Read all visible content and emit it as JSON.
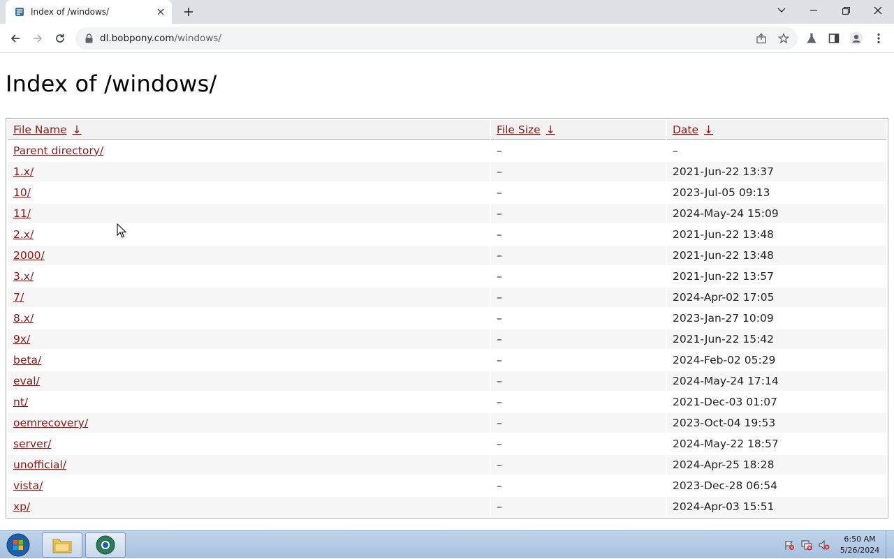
{
  "browser": {
    "tab_title": "Index of /windows/",
    "url_host": "dl.bobpony.com",
    "url_path": "/windows/"
  },
  "page": {
    "title": "Index of /windows/",
    "columns": {
      "name": "File Name",
      "size": "File Size",
      "date": "Date",
      "sort_arrow": "↓"
    },
    "rows": [
      {
        "name": "Parent directory/",
        "size": "–",
        "date": "–"
      },
      {
        "name": "1.x/",
        "size": "–",
        "date": "2021-Jun-22 13:37"
      },
      {
        "name": "10/",
        "size": "–",
        "date": "2023-Jul-05 09:13"
      },
      {
        "name": "11/",
        "size": "–",
        "date": "2024-May-24 15:09"
      },
      {
        "name": "2.x/",
        "size": "–",
        "date": "2021-Jun-22 13:48"
      },
      {
        "name": "2000/",
        "size": "–",
        "date": "2021-Jun-22 13:48"
      },
      {
        "name": "3.x/",
        "size": "–",
        "date": "2021-Jun-22 13:57"
      },
      {
        "name": "7/",
        "size": "–",
        "date": "2024-Apr-02 17:05"
      },
      {
        "name": "8.x/",
        "size": "–",
        "date": "2023-Jan-27 10:09"
      },
      {
        "name": "9x/",
        "size": "–",
        "date": "2021-Jun-22 15:42"
      },
      {
        "name": "beta/",
        "size": "–",
        "date": "2024-Feb-02 05:29"
      },
      {
        "name": "eval/",
        "size": "–",
        "date": "2024-May-24 17:14"
      },
      {
        "name": "nt/",
        "size": "–",
        "date": "2021-Dec-03 01:07"
      },
      {
        "name": "oemrecovery/",
        "size": "–",
        "date": "2023-Oct-04 19:53"
      },
      {
        "name": "server/",
        "size": "–",
        "date": "2024-May-22 18:57"
      },
      {
        "name": "unofficial/",
        "size": "–",
        "date": "2024-Apr-25 18:28"
      },
      {
        "name": "vista/",
        "size": "–",
        "date": "2023-Dec-28 06:54"
      },
      {
        "name": "xp/",
        "size": "–",
        "date": "2024-Apr-03 15:51"
      }
    ]
  },
  "taskbar": {
    "time": "6:50 AM",
    "date": "5/26/2024"
  },
  "colors": {
    "link": "#8b1a1a",
    "tabstrip_bg": "#dee1e6",
    "taskbar_bg": "#a8c1e0"
  }
}
